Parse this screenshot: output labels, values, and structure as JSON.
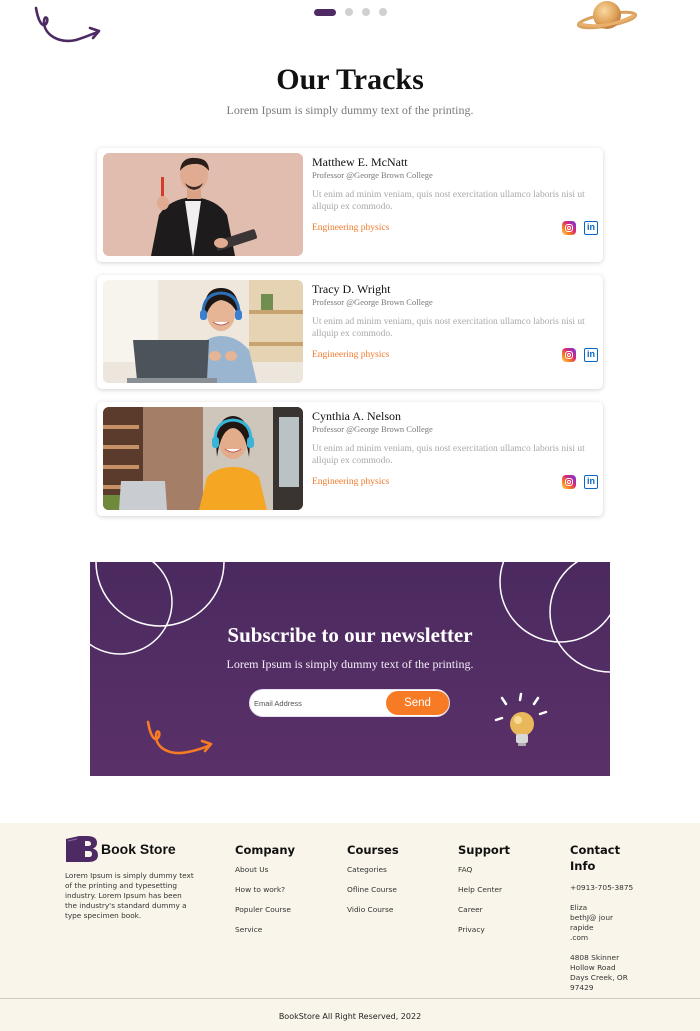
{
  "hero": {
    "title": "Our Tracks",
    "subtitle": "Lorem Ipsum is simply dummy text of the printing.",
    "carousel_dots": 4,
    "active_dot": 0
  },
  "tracks": [
    {
      "name": "Matthew E. McNatt",
      "role": "Professor @George Brown College",
      "description": "Ut enim ad minim veniam, quis nost exercitation ullamco laboris nisi ut allquip ex commodo.",
      "track": "Engineering physics"
    },
    {
      "name": "Tracy D. Wright",
      "role": "Professor @George Brown College",
      "description": "Ut enim ad minim veniam, quis nost exercitation ullamco laboris nisi ut allquip ex commodo.",
      "track": "Engineering physics"
    },
    {
      "name": "Cynthia A. Nelson",
      "role": "Professor @George Brown College",
      "description": "Ut enim ad minim veniam, quis nost exercitation ullamco laboris nisi ut allquip ex commodo.",
      "track": "Engineering physics"
    }
  ],
  "social_icons": [
    "instagram-icon",
    "linkedin-icon"
  ],
  "newsletter": {
    "title": "Subscribe to our newsletter",
    "subtitle": "Lorem Ipsum is simply dummy text of the printing.",
    "email_placeholder": "Email Address",
    "send_label": "Send"
  },
  "footer": {
    "brand": "Book Store",
    "about": "Lorem Ipsum is simply dummy text of the printing and typesetting industry. Lorem Ipsum has been the industry's standard dummy a type specimen book.",
    "company": {
      "heading": "Company",
      "links": [
        "About Us",
        "How to work?",
        "Populer Course",
        "Service"
      ]
    },
    "courses": {
      "heading": "Courses",
      "links": [
        "Categories",
        "Ofline Course",
        "Vidio Course"
      ]
    },
    "support": {
      "heading": "Support",
      "links": [
        "FAQ",
        "Help Center",
        "Career",
        "Privacy"
      ]
    },
    "contact": {
      "heading_line1": "Contact",
      "heading_line2": "Info",
      "phone": "+0913-705-3875",
      "email_line1": "Eliza",
      "email_line2": "bethJ@ jour",
      "email_line3": "rapide",
      "email_line4": ".com",
      "address_line1": "4808 Skinner",
      "address_line2": "Hollow Road",
      "address_line3": "Days Creek, OR",
      "address_line4": "97429"
    },
    "copyright": "BookStore All Right Reserved, 2022"
  },
  "colors": {
    "brand_purple": "#4d2a63",
    "accent_orange": "#f77a24",
    "footer_bg": "#f9f5ea"
  }
}
